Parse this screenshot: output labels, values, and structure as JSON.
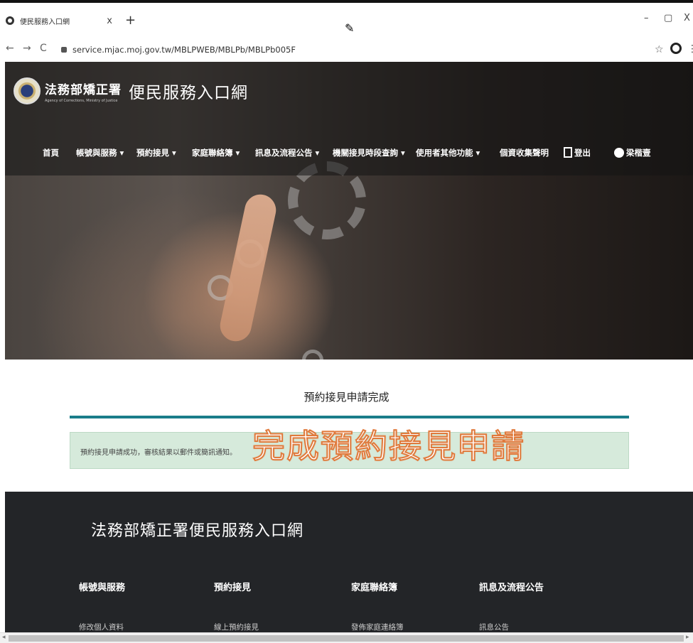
{
  "browser": {
    "tab_title": "便民服務入口網",
    "tab_close": "x",
    "new_tab": "+",
    "url": "service.mjac.moj.gov.tw/MBLPWEB/MBLPb/MBLPb005F",
    "minimize": "–",
    "maximize": "▢",
    "close": "X"
  },
  "site": {
    "logo_main": "法務部矯正署",
    "logo_sub": "Agency of Corrections, Ministry of Justice",
    "portal_title": "便民服務入口網",
    "nav": [
      {
        "label": "首頁"
      },
      {
        "label": "帳號與服務 ▾"
      },
      {
        "label": "預約接見 ▾"
      },
      {
        "label": "家庭聯絡簿 ▾"
      },
      {
        "label": "訊息及流程公告 ▾"
      },
      {
        "label": "機關接見時段查詢 ▾"
      },
      {
        "label": "使用者其他功能 ▾"
      },
      {
        "label": "個資收集聲明"
      },
      {
        "label": "登出"
      },
      {
        "label": "梁楷壹"
      }
    ]
  },
  "content": {
    "heading": "預約接見申請完成",
    "alert_message": "預約接見申請成功，審核結果以郵件或簡訊通知。",
    "overlay_caption": "完成預約接見申請"
  },
  "footer": {
    "title": "法務部矯正署便民服務入口網",
    "columns": [
      {
        "heading": "帳號與服務",
        "link": "修改個人資料"
      },
      {
        "heading": "預約接見",
        "link": "線上預約接見"
      },
      {
        "heading": "家庭聯絡簿",
        "link": "發佈家庭連絡簿"
      },
      {
        "heading": "訊息及流程公告",
        "link": "訊息公告"
      }
    ]
  },
  "colors": {
    "accent_line": "#1a7d8a",
    "alert_bg": "#d6eadb",
    "overlay_stroke": "#e07a3c",
    "footer_bg": "#232528"
  }
}
